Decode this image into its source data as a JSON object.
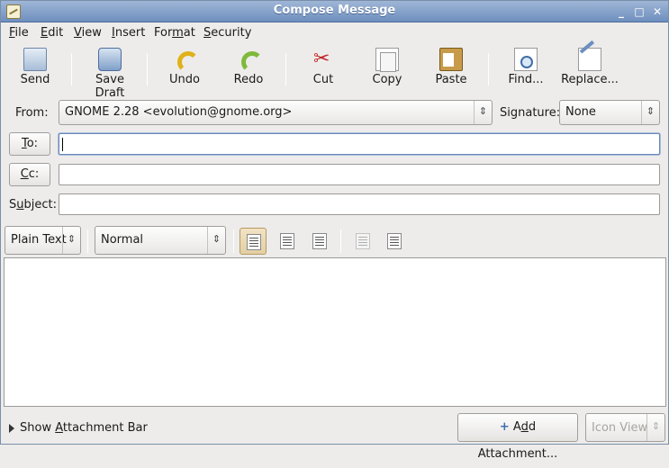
{
  "window": {
    "title": "Compose Message"
  },
  "menu": [
    {
      "label": "File",
      "mn": "F",
      "rest": "ile"
    },
    {
      "label": "Edit",
      "mn": "E",
      "rest": "dit"
    },
    {
      "label": "View",
      "mn": "V",
      "rest": "iew"
    },
    {
      "label": "Insert",
      "mn": "I",
      "rest": "nsert"
    },
    {
      "label": "Format",
      "pre": "For",
      "mn": "m",
      "rest": "at"
    },
    {
      "label": "Security",
      "mn": "S",
      "rest": "ecurity"
    }
  ],
  "toolbar": {
    "send": "Send",
    "save_draft": "Save Draft",
    "undo": "Undo",
    "redo": "Redo",
    "cut": "Cut",
    "copy": "Copy",
    "paste": "Paste",
    "find": "Find...",
    "replace": "Replace..."
  },
  "header": {
    "from_label": "From:",
    "from_value": "GNOME 2.28 <evolution@gnome.org>",
    "signature_label": "Signature:",
    "signature_value": "None",
    "to_mn": "T",
    "to_rest": "o:",
    "cc_mn": "C",
    "cc_rest": "c:",
    "subject_pre": "S",
    "subject_mn": "u",
    "subject_rest": "bject:",
    "to_value": "",
    "cc_value": "",
    "subject_value": ""
  },
  "format": {
    "mode": "Plain Text",
    "paragraph_style": "Normal"
  },
  "bottom": {
    "attach_bar_pre": "Show ",
    "attach_bar_mn": "A",
    "attach_bar_rest": "ttachment Bar",
    "add_pre": "A",
    "add_mn": "d",
    "add_rest": "d Attachment...",
    "view_mode": "Icon View"
  }
}
